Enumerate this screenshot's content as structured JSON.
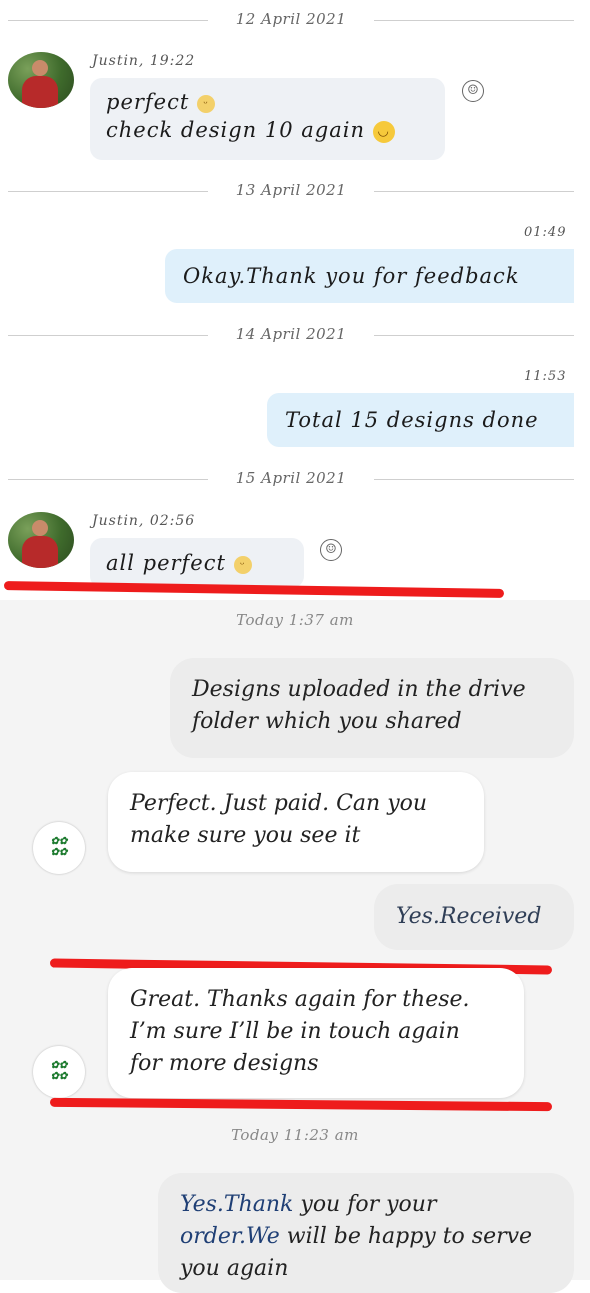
{
  "skype": {
    "sep1": "12 April 2021",
    "msg1": {
      "sender": "Justin, 19:22",
      "line1": "perfect",
      "line2": "check design 10 again"
    },
    "sep2": "13 April 2021",
    "msg2": {
      "time": "01:49",
      "text": "Okay.Thank you for feedback"
    },
    "sep3": "14 April 2021",
    "msg3": {
      "time": "11:53",
      "text": "Total 15 designs done"
    },
    "sep4": "15 April 2021",
    "msg4": {
      "sender": "Justin, 02:56",
      "text": "all perfect"
    },
    "react_icon": "smiley-outline-icon",
    "emoji_icon": "emoji-icon"
  },
  "messenger": {
    "stamp1": "Today 1:37 am",
    "m1": {
      "line1": "Designs uploaded in the drive",
      "line2": "folder which you shared"
    },
    "m2": {
      "line1": "Perfect. Just paid. Can you",
      "line2": "make sure you see it"
    },
    "m3": {
      "text": "Yes.Received"
    },
    "m4": {
      "line1": "Great. Thanks again for these.",
      "line2": "I’m sure I’ll be in touch again",
      "line3": "for more designs"
    },
    "stamp2": "Today 11:23 am",
    "m5": {
      "a": "Yes.",
      "b": "Thank",
      "c": " you for your",
      "d": "order.",
      "e": "We",
      "f": " will be happy to serve",
      "g": "you again"
    }
  },
  "colors": {
    "annotation_red": "#ee1c1c",
    "outgoing_bubble": "#dff0fb"
  }
}
